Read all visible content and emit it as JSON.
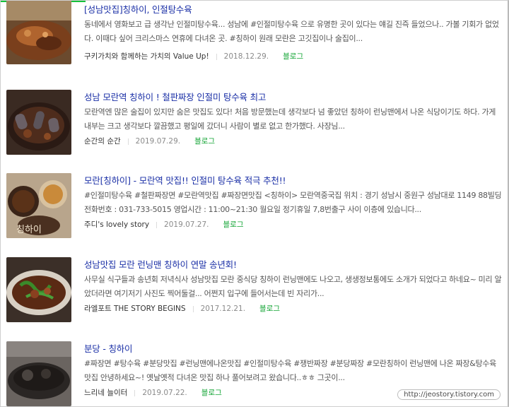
{
  "results": [
    {
      "title": "[성남맛집]칭하이, 인절탕수육",
      "desc": "동네에서 영화보고 급 생각난 인절미탕수육... 성남에 #인절미탕수육 으로 유명한 곳이 있다는 얘길 진즉 들었으나.. 가볼 기회가 없었다. 이때다 싶어 크리스마스 연휴에 다녀온 곳. #칭하이 원래 모란은 고깃집이나 술집이...",
      "author": "구키가치와 함께하는 가치의 Value Up!",
      "date": "2018.12.29.",
      "category": "블로그"
    },
    {
      "title": "성남 모란역 칭하이 ! 철판짜장 인절미 탕수육 최고",
      "desc": "모란역엔 많은 술집이 있지만 숨은 맛집도 있다! 처음 방문했는데 생각보다 넘 좋았던 칭하이 런닝맨에서 나온 식당이기도 하다. 가게 내부는 크고 생각보다 깔끔했고 평일에 갔더니 사람이 별로 없고 한가했다. 사장님...",
      "author": "순간의 순간",
      "date": "2019.07.29.",
      "category": "블로그"
    },
    {
      "title": "모란[칭하이] - 모란역 맛집!! 인절미 탕수육 적극 추천!!",
      "desc": "#인절미탕수육 #철판짜장면 #모란역맛집 #짜장면맛집 <칭하이> 모란역중국집 위치 : 경기 성남시 중원구 성남대로 1149 88빌딩 전화번호 : 031-733-5015 영업시간 : 11:00~21:30 월요일 정기휴일 7,8번출구 사이 이층에 있습니다...",
      "author": "주디's lovely story",
      "date": "2019.07.27.",
      "category": "블로그"
    },
    {
      "title": "성남맛집 모란 런닝맨 칭하이 연말 송년회!",
      "desc": "사무실 식구들과 송년회 저녁식사 성남맛집 모란 중식당 칭하이 런닝맨에도 나오고, 생생정보통에도 소개가 되었다고 하네요~ 미리 알았더라면 여기저기 사진도 찍어둘걸... 어쩐지 입구에 들어서는데 빈 자리가...",
      "author": "라엘포트 THE STORY BEGINS",
      "date": "2017.12.21.",
      "category": "블로그"
    },
    {
      "title": "분당 - 칭하이",
      "desc": "#짜장면 #탕수육 #분당맛집 #런닝맨에나온맛집 #인절미탕수육 #쟁반짜장 #분당짜장 #모란칭하이 런닝맨에 나온 짜장&탕수육 맛집 안녕하세요~! 옛날옛적 다녀온 맛집 하나 풀어보려고 왔습니다..ㅎㅎ 그곳이...",
      "author": "느리네 늘이터",
      "date": "2019.07.22.",
      "category": "블로그"
    }
  ],
  "watermark": "http://jeostory.tistory.com"
}
